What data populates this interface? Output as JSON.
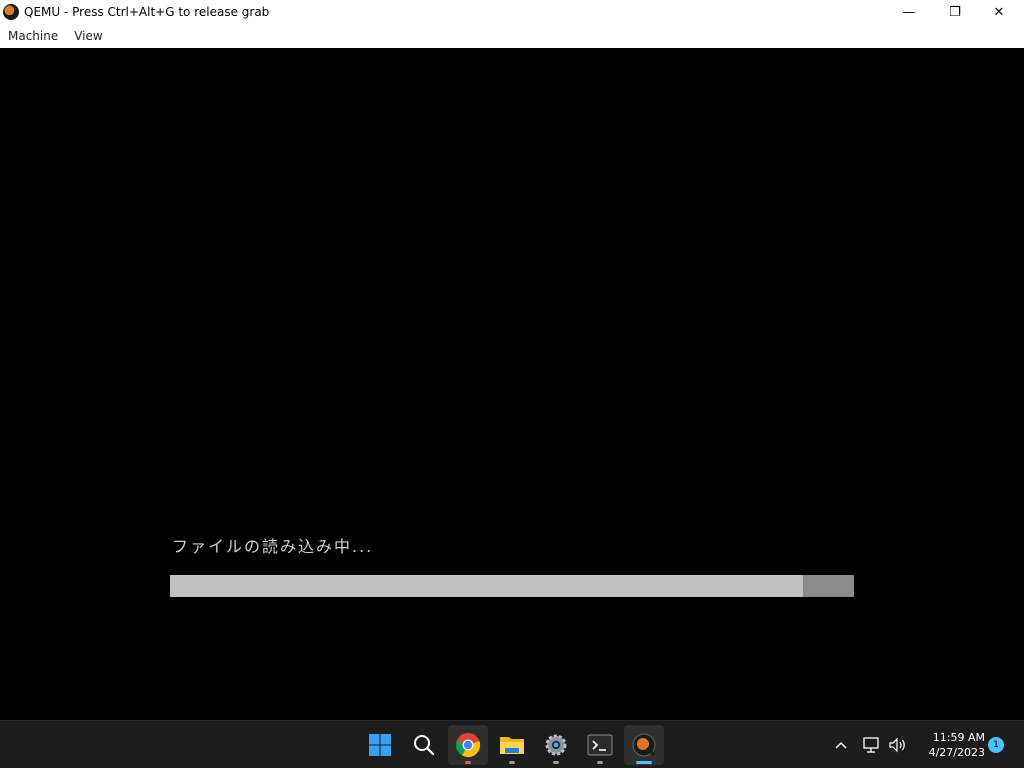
{
  "window": {
    "title": "QEMU - Press Ctrl+Alt+G to release grab",
    "controls": {
      "minimize": "—",
      "maximize": "❐",
      "close": "✕"
    }
  },
  "menu": {
    "items": [
      {
        "label": "Machine"
      },
      {
        "label": "View"
      }
    ]
  },
  "vm_screen": {
    "loading_text": "ファイルの読み込み中...",
    "progress_fraction": 0.925,
    "colors": {
      "track": "#8a8a8a",
      "fill": "#c0c0c0",
      "text": "#cfcfcf"
    }
  },
  "taskbar": {
    "apps": [
      {
        "name": "start-icon"
      },
      {
        "name": "search-icon"
      },
      {
        "name": "chrome-icon"
      },
      {
        "name": "file-explorer-icon"
      },
      {
        "name": "settings-icon"
      },
      {
        "name": "terminal-icon"
      },
      {
        "name": "qemu-icon"
      }
    ],
    "tray": {
      "chevron": "^",
      "time": "11:59 AM",
      "date": "4/27/2023",
      "notification_count": "1"
    }
  }
}
